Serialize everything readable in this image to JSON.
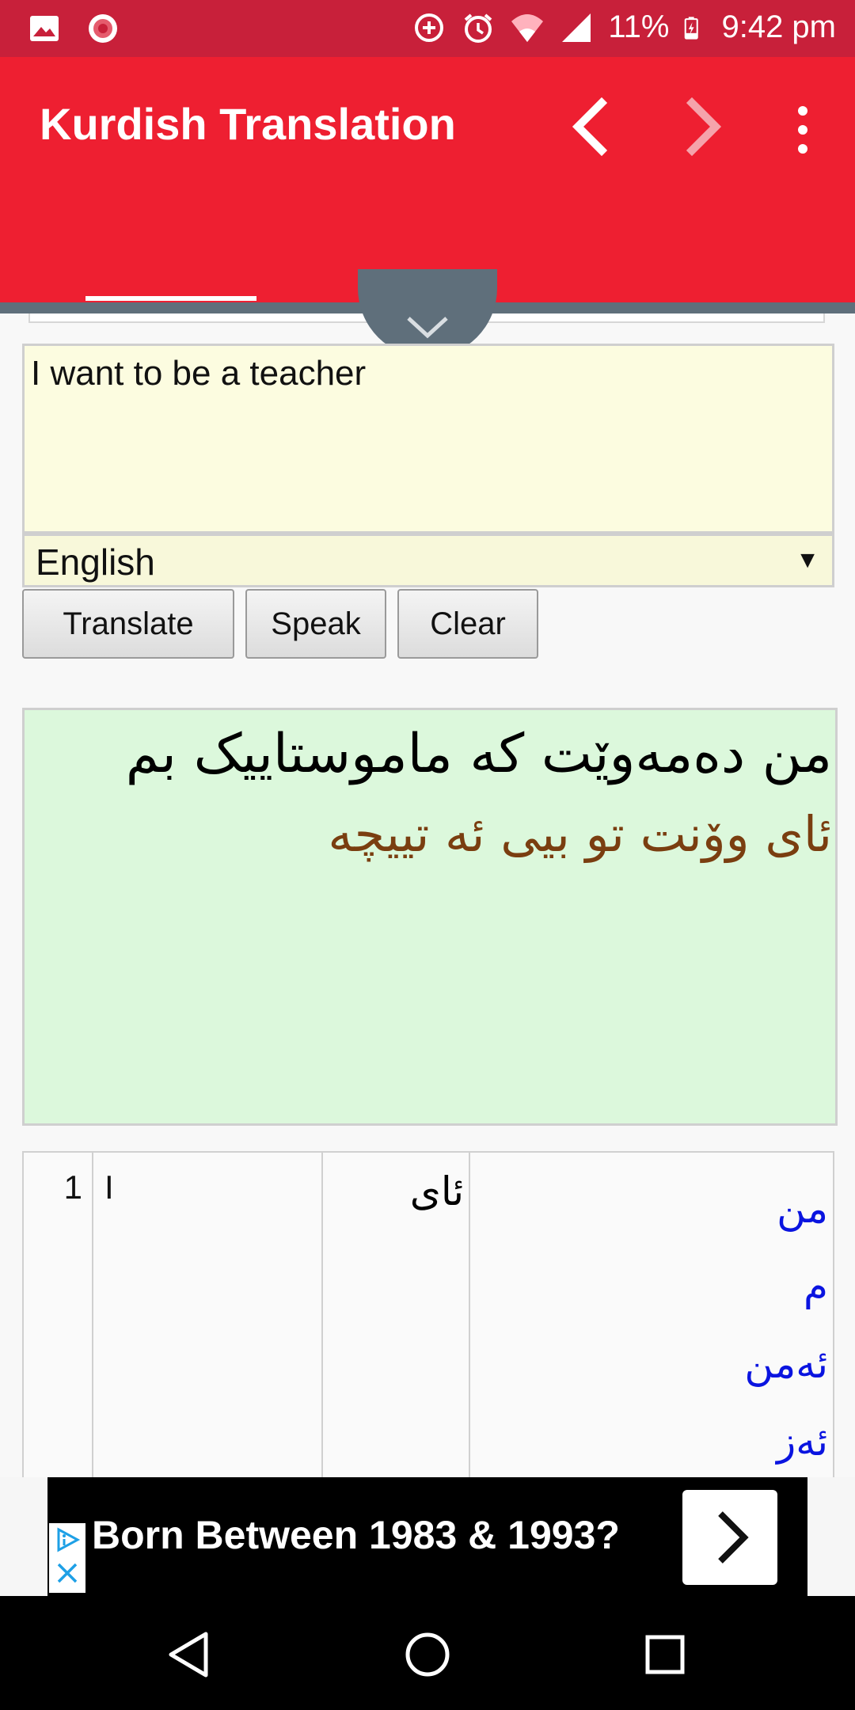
{
  "status_bar": {
    "time": "9:42 pm",
    "battery": "11%",
    "icons": [
      "image-icon",
      "record-icon",
      "data-saver-icon",
      "alarm-icon",
      "wifi-icon",
      "signal-icon",
      "battery-charging-icon"
    ]
  },
  "app_bar": {
    "title": "Kurdish Translation",
    "back_icon": "chevron-left-icon",
    "forward_icon": "chevron-right-icon",
    "menu_icon": "more-vert-icon",
    "color": "#ee1f31"
  },
  "input": {
    "text": "I want to be a teacher",
    "language": "English"
  },
  "buttons": {
    "translate": "Translate",
    "speak": "Speak",
    "clear": "Clear"
  },
  "result": {
    "sorani": "من دەمەوێت  کە ماموستاییک بم",
    "latin_script": "ئای وۆنت تو بیی ئە تیيچە"
  },
  "word_table": {
    "rows": [
      {
        "num": "1",
        "english": "I",
        "pronunciation": "ئای",
        "sorani": [
          "من",
          "م",
          "ئەمن",
          "ئەز"
        ]
      }
    ]
  },
  "ad": {
    "headline": "Born Between 1983 & 1993?",
    "arrow_icon": "chevron-right-icon"
  },
  "nav_bar": {
    "icons": [
      "back-triangle-icon",
      "home-circle-icon",
      "recents-square-icon"
    ]
  }
}
